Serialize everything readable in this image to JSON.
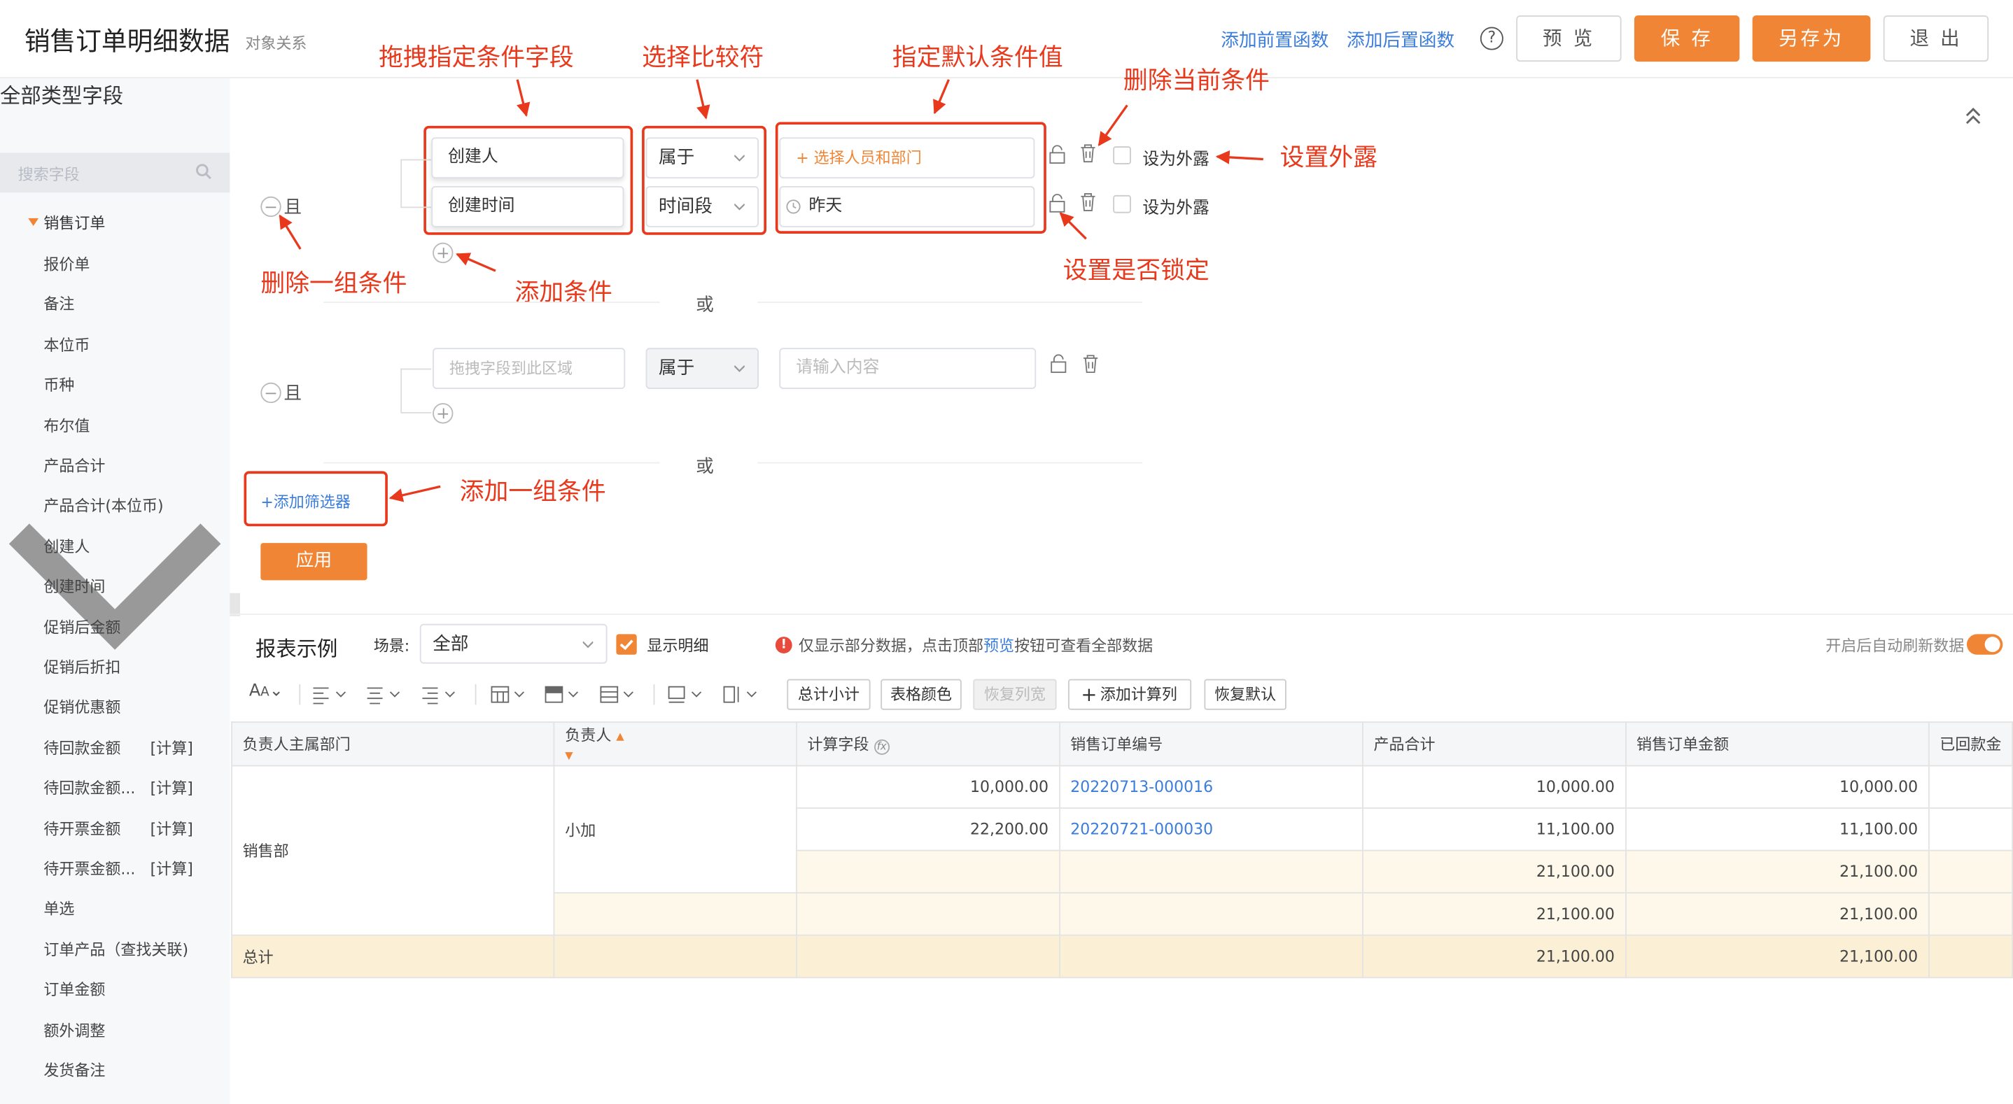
{
  "header": {
    "title": "销售订单明细数据",
    "subtitle": "对象关系",
    "add_pre": "添加前置函数",
    "add_post": "添加后置函数",
    "help": "?",
    "preview": "预 览",
    "save": "保 存",
    "save_as": "另存为",
    "exit": "退 出"
  },
  "sidebar": {
    "header": "全部类型字段",
    "search_placeholder": "搜索字段",
    "group": "销售订单",
    "items": [
      {
        "label": "报价单"
      },
      {
        "label": "备注"
      },
      {
        "label": "本位币"
      },
      {
        "label": "币种"
      },
      {
        "label": "布尔值"
      },
      {
        "label": "产品合计"
      },
      {
        "label": "产品合计(本位币)"
      },
      {
        "label": "创建人"
      },
      {
        "label": "创建时间"
      },
      {
        "label": "促销后金额"
      },
      {
        "label": "促销后折扣"
      },
      {
        "label": "促销优惠额"
      },
      {
        "label": "待回款金额",
        "tag": "[计算]"
      },
      {
        "label": "待回款金额...",
        "tag": "[计算]"
      },
      {
        "label": "待开票金额",
        "tag": "[计算]"
      },
      {
        "label": "待开票金额...",
        "tag": "[计算]"
      },
      {
        "label": "单选"
      },
      {
        "label": "订单产品（查找关联)"
      },
      {
        "label": "订单金额"
      },
      {
        "label": "额外调整"
      },
      {
        "label": "发货备注"
      }
    ]
  },
  "filter": {
    "and_label": "且",
    "or_label": "或",
    "group1": {
      "field1": "创建人",
      "field2": "创建时间",
      "op1": "属于",
      "op2": "时间段",
      "val1": "+ 选择人员和部门",
      "val2": "昨天",
      "expose1": "设为外露",
      "expose2": "设为外露"
    },
    "group2": {
      "field_placeholder": "拖拽字段到此区域",
      "op": "属于",
      "val_placeholder": "请输入内容"
    },
    "add_filter": "+添加筛选器",
    "apply": "应用"
  },
  "annotations": {
    "drag_field": "拖拽指定条件字段",
    "select_op": "选择比较符",
    "default_val": "指定默认条件值",
    "delete_cond": "删除当前条件",
    "set_expose": "设置外露",
    "set_lock": "设置是否锁定",
    "delete_group": "删除一组条件",
    "add_cond": "添加条件",
    "add_group": "添加一组条件"
  },
  "report": {
    "title": "报表示例",
    "scene_label": "场景:",
    "scene_value": "全部",
    "show_detail": "显示明细",
    "notice_pre": "仅显示部分数据，点击顶部",
    "notice_link": "预览",
    "notice_post": "按钮可查看全部数据",
    "auto_refresh": "开启后自动刷新数据",
    "auto_refresh_on": true,
    "toolbar": {
      "subtotal": "总计小计",
      "table_color": "表格颜色",
      "restore_width": "恢复列宽",
      "add_calc": "添加计算列",
      "restore_default": "恢复默认"
    }
  },
  "table": {
    "columns": [
      "负责人主属部门",
      "负责人",
      "计算字段",
      "销售订单编号",
      "产品合计",
      "销售订单金额",
      "已回款金"
    ],
    "dept": "销售部",
    "owner": "小加",
    "rows": [
      {
        "calc": "10,000.00",
        "order": "20220713-000016",
        "total": "10,000.00",
        "amount": "10,000.00"
      },
      {
        "calc": "22,200.00",
        "order": "20220721-000030",
        "total": "11,100.00",
        "amount": "11,100.00"
      },
      {
        "calc": "",
        "order": "",
        "total": "21,100.00",
        "amount": "21,100.00"
      },
      {
        "calc": "",
        "order": "",
        "total": "21,100.00",
        "amount": "21,100.00"
      }
    ],
    "total_label": "总计",
    "grand_total": "21,100.00",
    "grand_amount": "21,100.00"
  },
  "colors": {
    "accent": "#f08635",
    "annotation": "#e8391c",
    "link": "#3b7ddd"
  }
}
